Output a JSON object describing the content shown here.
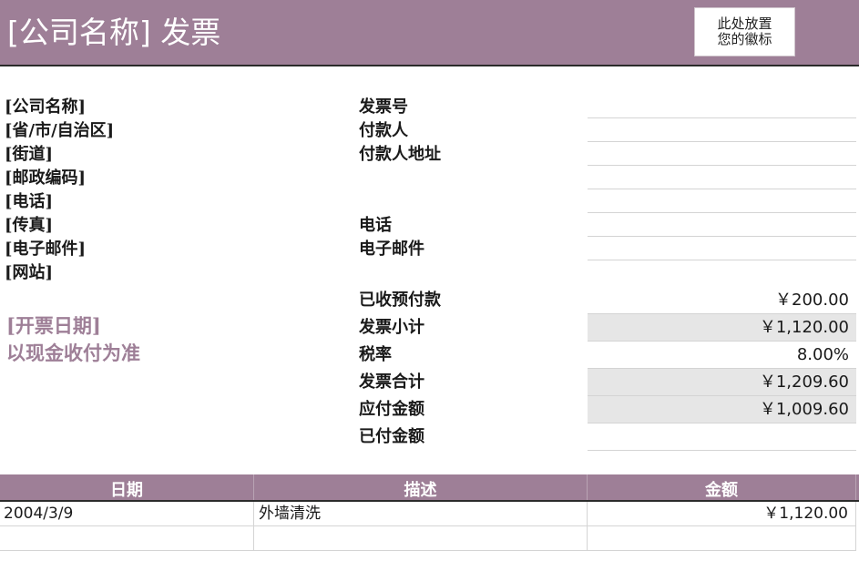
{
  "header": {
    "title": "[公司名称] 发票",
    "logo_line1": "此处放置",
    "logo_line2": "您的徽标"
  },
  "company": {
    "name": "[公司名称]",
    "region": "[省/市/自治区]",
    "street": "[街道]",
    "postal": "[邮政编码]",
    "phone": "[电话]",
    "fax": "[传真]",
    "email": "[电子邮件]",
    "website": "[网站]"
  },
  "invoice_fields": {
    "invoice_no": "发票号",
    "payer": "付款人",
    "payer_address": "付款人地址",
    "phone": "电话",
    "email": "电子邮件"
  },
  "billing": {
    "date_placeholder": "[开票日期]",
    "cash_basis": "以现金收付为准"
  },
  "summary": {
    "labels": {
      "prepaid": "已收预付款",
      "subtotal": "发票小计",
      "tax_rate": "税率",
      "total": "发票合计",
      "amount_due": "应付金额",
      "amount_paid": "已付金额"
    },
    "values": {
      "prepaid": "￥200.00",
      "subtotal": "￥1,120.00",
      "tax_rate": "8.00%",
      "total": "￥1,209.60",
      "amount_due": "￥1,009.60",
      "amount_paid": ""
    }
  },
  "table": {
    "headers": {
      "date": "日期",
      "description": "描述",
      "amount": "金额"
    },
    "rows": [
      {
        "date": "2004/3/9",
        "description": "外墙清洗",
        "amount": "￥1,120.00"
      },
      {
        "date": "",
        "description": "",
        "amount": ""
      }
    ]
  },
  "colors": {
    "accent": "#9e7f97",
    "shaded_cell": "#e6e6e6"
  }
}
